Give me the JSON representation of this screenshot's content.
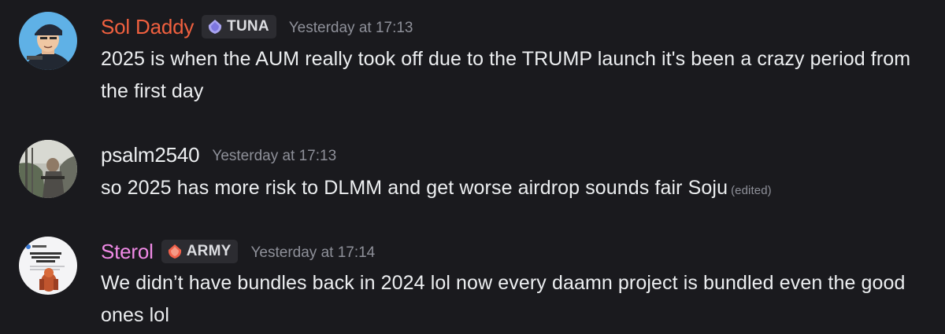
{
  "messages": [
    {
      "username": "Sol Daddy",
      "username_color": "#f0603f",
      "tag": "TUNA",
      "tag_icon": "crystal-icon",
      "tag_icon_color": "#a9a4f0",
      "timestamp": "Yesterday at 17:13",
      "text": "2025 is when the AUM really took off due to the TRUMP launch it's been a crazy period from the first day",
      "edited": ""
    },
    {
      "username": "psalm2540",
      "username_color": "#eceef0",
      "tag": "",
      "timestamp": "Yesterday at 17:13",
      "text": "so 2025 has more risk to DLMM and get worse airdrop sounds fair Soju",
      "edited": "(edited)"
    },
    {
      "username": "Sterol",
      "username_color": "#f08ae6",
      "tag": "ARMY",
      "tag_icon": "crystal-icon",
      "tag_icon_color": "#f0604a",
      "timestamp": "Yesterday at 17:14",
      "text": "We didn’t have bundles back in 2024 lol now every daamn project is bundled even the good ones lol",
      "edited": ""
    }
  ]
}
